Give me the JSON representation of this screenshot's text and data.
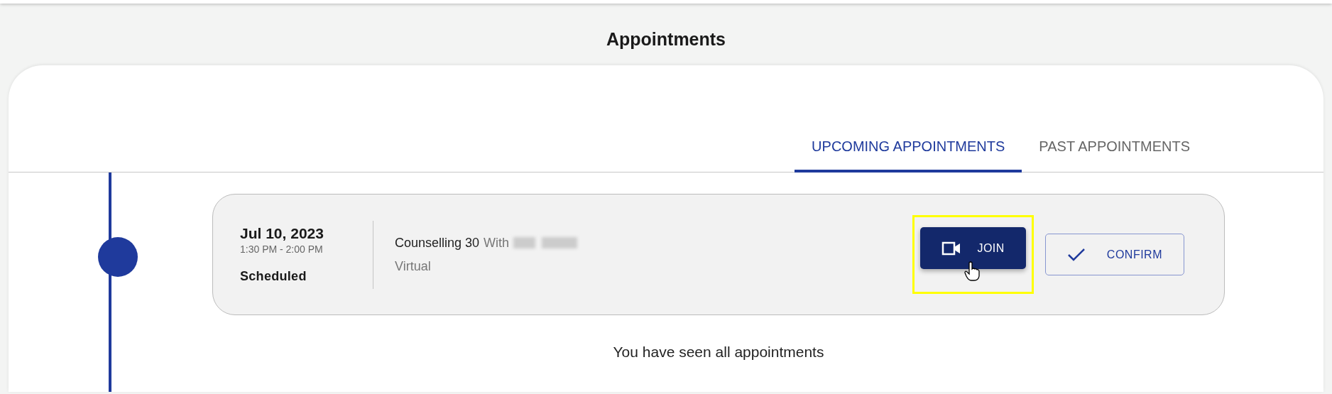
{
  "page_title": "Appointments",
  "tabs": [
    {
      "label": "UPCOMING APPOINTMENTS",
      "selected": true
    },
    {
      "label": "PAST APPOINTMENTS",
      "selected": false
    }
  ],
  "appointments": [
    {
      "date": "Jul 10, 2023",
      "time": "1:30 PM - 2:00 PM",
      "status": "Scheduled",
      "service": "Counselling 30",
      "with_label": "With",
      "mode": "Virtual",
      "actions": [
        {
          "kind": "join",
          "label": "JOIN",
          "highlighted": true
        },
        {
          "kind": "confirm",
          "label": "CONFIRM",
          "highlighted": false
        }
      ]
    }
  ],
  "end_message": "You have seen all appointments"
}
